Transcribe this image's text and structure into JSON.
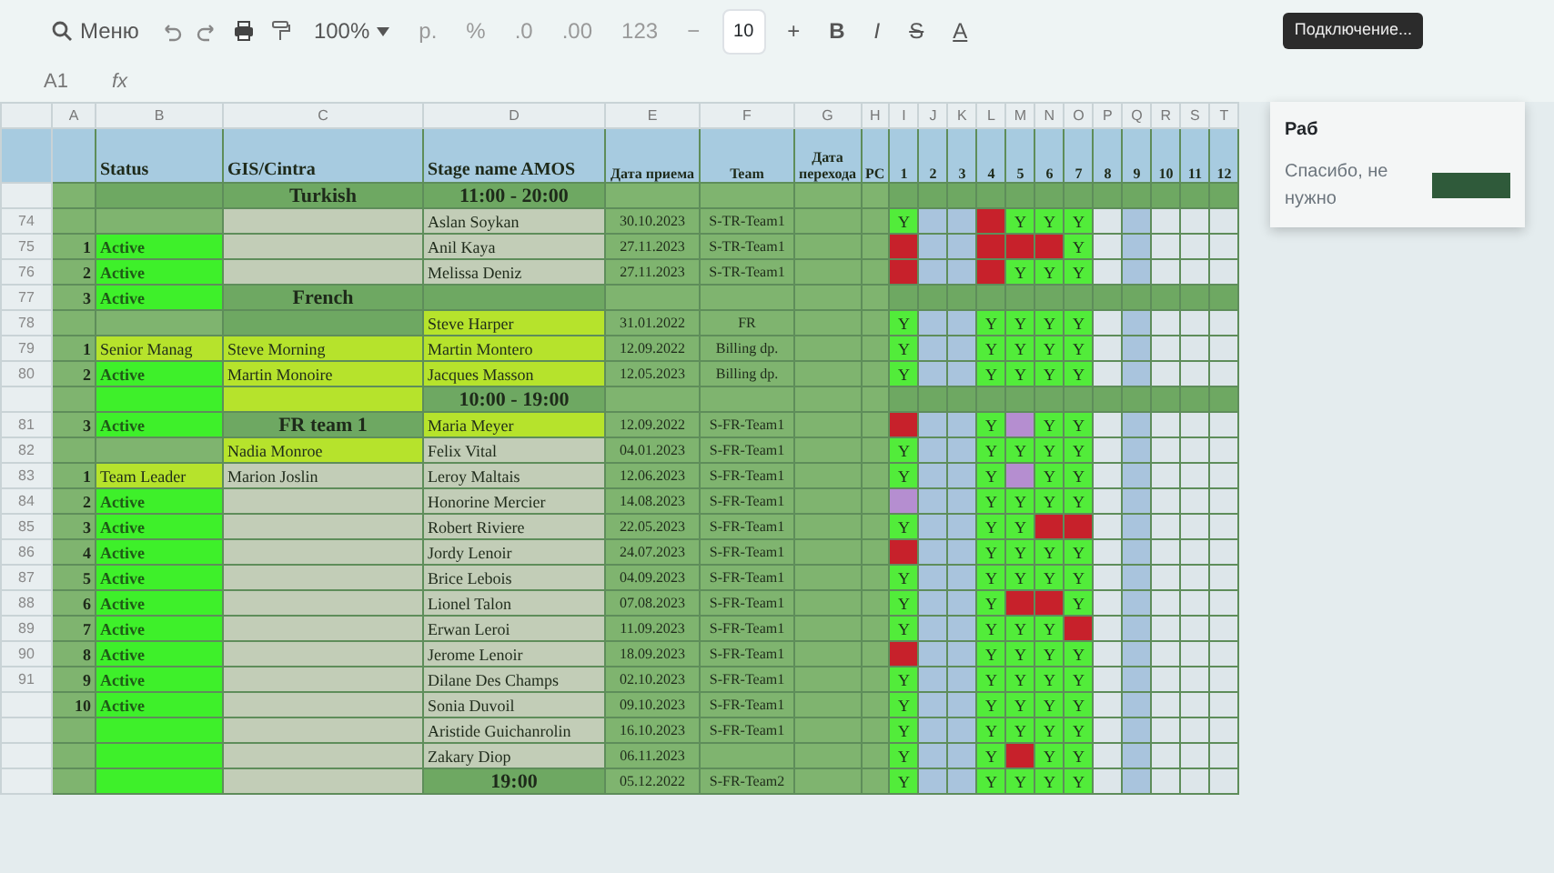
{
  "toolbar": {
    "menu": "Меню",
    "zoom": "100%",
    "currency": "р.",
    "percent": "%",
    "decimals_less": ".0",
    "decimals_more": ".00",
    "number_format": "123",
    "font_minus": "−",
    "font_size": "10",
    "font_plus": "+",
    "bold": "B",
    "italic": "I",
    "strike": "S",
    "text_color": "A"
  },
  "connection_chip": "Подключение...",
  "formula_bar": {
    "cell_ref": "A1",
    "fx": "fx"
  },
  "column_letters": [
    "A",
    "B",
    "C",
    "D",
    "E",
    "F",
    "G",
    "H"
  ],
  "day_letters": [
    "I",
    "J",
    "K",
    "L",
    "M",
    "N",
    "O",
    "P",
    "Q",
    "R",
    "S",
    "T"
  ],
  "headers": [
    "Status",
    "GIS/Cintra",
    "Stage name AMOS",
    "Дата приема",
    "Team",
    "Дата перехода",
    "PC"
  ],
  "day_numbers": [
    "1",
    "2",
    "3",
    "4",
    "5",
    "6",
    "7",
    "8",
    "9",
    "10",
    "11",
    "12"
  ],
  "rows": [
    {
      "kind": "section",
      "cells": [
        {
          "kind": "plain"
        },
        {
          "kind": "section"
        },
        {
          "kind": "section",
          "text": "Turkish"
        },
        {
          "kind": "section",
          "text": "11:00 - 20:00"
        },
        {
          "kind": "plain"
        },
        {
          "kind": "plain"
        }
      ]
    },
    {
      "kind": "person",
      "number": "74",
      "cells": [
        {
          "kind": "plain"
        },
        {
          "kind": "plain"
        },
        {
          "kind": "blank"
        },
        {
          "kind": "blank",
          "text": "Aslan Soykan"
        },
        {
          "kind": "plain",
          "text": "30.10.2023"
        },
        {
          "kind": "plain",
          "text": "S-TR-Team1"
        }
      ],
      "days": [
        {
          "kind": "work",
          "text": "Y"
        },
        {
          "kind": "off"
        },
        {
          "kind": "work",
          "text": "Y"
        },
        {
          "kind": "work",
          "text": "Y"
        },
        {
          "kind": "work",
          "text": "Y"
        }
      ]
    },
    {
      "kind": "person",
      "number": "75",
      "cells": [
        {
          "kind": "plain",
          "text": "1"
        },
        {
          "kind": "active",
          "text": "Active"
        },
        {
          "kind": "blank"
        },
        {
          "kind": "blank",
          "text": "Anil Kaya"
        },
        {
          "kind": "plain",
          "text": "27.11.2023"
        },
        {
          "kind": "plain",
          "text": "S-TR-Team1"
        }
      ],
      "days": [
        {
          "kind": "off"
        },
        {
          "kind": "off"
        },
        {
          "kind": "off"
        },
        {
          "kind": "off"
        },
        {
          "kind": "work",
          "text": "Y"
        }
      ]
    },
    {
      "kind": "person",
      "number": "76",
      "cells": [
        {
          "kind": "plain",
          "text": "2"
        },
        {
          "kind": "active",
          "text": "Active"
        },
        {
          "kind": "blank"
        },
        {
          "kind": "blank",
          "text": "Melissa Deniz"
        },
        {
          "kind": "plain",
          "text": "27.11.2023"
        },
        {
          "kind": "plain",
          "text": "S-TR-Team1"
        }
      ],
      "days": [
        {
          "kind": "off"
        },
        {
          "kind": "off"
        },
        {
          "kind": "work",
          "text": "Y"
        },
        {
          "kind": "work",
          "text": "Y"
        },
        {
          "kind": "work",
          "text": "Y"
        }
      ]
    },
    {
      "kind": "section",
      "number": "77",
      "cells": [
        {
          "kind": "plain",
          "text": "3"
        },
        {
          "kind": "active",
          "text": "Active"
        },
        {
          "kind": "section",
          "text": "French"
        },
        {
          "kind": "section"
        },
        {
          "kind": "plain"
        },
        {
          "kind": "plain"
        }
      ]
    },
    {
      "kind": "person",
      "number": "78",
      "cells": [
        {
          "kind": "plain"
        },
        {
          "kind": "plain"
        },
        {
          "kind": "section"
        },
        {
          "kind": "highlight",
          "text": "Steve Harper"
        },
        {
          "kind": "plain",
          "text": "31.01.2022"
        },
        {
          "kind": "plain",
          "text": "FR"
        }
      ],
      "days": [
        {
          "kind": "work",
          "text": "Y"
        },
        {
          "kind": "work",
          "text": "Y"
        },
        {
          "kind": "work",
          "text": "Y"
        },
        {
          "kind": "work",
          "text": "Y"
        },
        {
          "kind": "work",
          "text": "Y"
        }
      ]
    },
    {
      "kind": "person",
      "number": "79",
      "cells": [
        {
          "kind": "plain",
          "text": "1"
        },
        {
          "kind": "highlight",
          "text": "Senior Manag"
        },
        {
          "kind": "highlight",
          "text": "Steve Morning"
        },
        {
          "kind": "highlight",
          "text": "Martin Montero"
        },
        {
          "kind": "plain",
          "text": "12.09.2022"
        },
        {
          "kind": "plain",
          "text": "Billing dp."
        }
      ],
      "days": [
        {
          "kind": "work",
          "text": "Y"
        },
        {
          "kind": "work",
          "text": "Y"
        },
        {
          "kind": "work",
          "text": "Y"
        },
        {
          "kind": "work",
          "text": "Y"
        },
        {
          "kind": "work",
          "text": "Y"
        }
      ]
    },
    {
      "kind": "person",
      "number": "80",
      "cells": [
        {
          "kind": "plain",
          "text": "2"
        },
        {
          "kind": "active",
          "text": "Active"
        },
        {
          "kind": "highlight",
          "text": "Martin Monoire"
        },
        {
          "kind": "highlight",
          "text": "Jacques Masson"
        },
        {
          "kind": "plain",
          "text": "12.05.2023"
        },
        {
          "kind": "plain",
          "text": "Billing dp."
        }
      ],
      "days": [
        {
          "kind": "work",
          "text": "Y"
        },
        {
          "kind": "work",
          "text": "Y"
        },
        {
          "kind": "work",
          "text": "Y"
        },
        {
          "kind": "work",
          "text": "Y"
        },
        {
          "kind": "work",
          "text": "Y"
        }
      ]
    },
    {
      "kind": "section",
      "cells": [
        {
          "kind": "plain"
        },
        {
          "kind": "active"
        },
        {
          "kind": "highlight"
        },
        {
          "kind": "section",
          "text": "10:00 - 19:00"
        },
        {
          "kind": "plain"
        },
        {
          "kind": "plain"
        }
      ]
    },
    {
      "kind": "person",
      "number": "81",
      "cells": [
        {
          "kind": "plain",
          "text": "3"
        },
        {
          "kind": "active",
          "text": "Active"
        },
        {
          "kind": "section",
          "text": "FR team 1"
        },
        {
          "kind": "highlight",
          "text": "Maria Meyer"
        },
        {
          "kind": "plain",
          "text": "12.09.2022"
        },
        {
          "kind": "plain",
          "text": "S-FR-Team1"
        }
      ],
      "days": [
        {
          "kind": "off"
        },
        {
          "kind": "work",
          "text": "Y"
        },
        {
          "kind": "extra"
        },
        {
          "kind": "work",
          "text": "Y"
        },
        {
          "kind": "work",
          "text": "Y"
        }
      ]
    },
    {
      "kind": "person",
      "number": "82",
      "cells": [
        {
          "kind": "plain"
        },
        {
          "kind": "plain"
        },
        {
          "kind": "highlight",
          "text": "Nadia Monroe"
        },
        {
          "kind": "blank",
          "text": "Felix Vital"
        },
        {
          "kind": "plain",
          "text": "04.01.2023"
        },
        {
          "kind": "plain",
          "text": "S-FR-Team1"
        }
      ],
      "days": [
        {
          "kind": "work",
          "text": "Y"
        },
        {
          "kind": "work",
          "text": "Y"
        },
        {
          "kind": "work",
          "text": "Y"
        },
        {
          "kind": "work",
          "text": "Y"
        },
        {
          "kind": "work",
          "text": "Y"
        }
      ]
    },
    {
      "kind": "person",
      "number": "83",
      "cells": [
        {
          "kind": "plain",
          "text": "1"
        },
        {
          "kind": "highlight",
          "text": "Team Leader"
        },
        {
          "kind": "blank",
          "text": "Marion Joslin"
        },
        {
          "kind": "blank",
          "text": "Leroy Maltais"
        },
        {
          "kind": "plain",
          "text": "12.06.2023"
        },
        {
          "kind": "plain",
          "text": "S-FR-Team1"
        }
      ],
      "days": [
        {
          "kind": "work",
          "text": "Y"
        },
        {
          "kind": "work",
          "text": "Y"
        },
        {
          "kind": "extra"
        },
        {
          "kind": "work",
          "text": "Y"
        },
        {
          "kind": "work",
          "text": "Y"
        }
      ]
    },
    {
      "kind": "person",
      "number": "84",
      "cells": [
        {
          "kind": "plain",
          "text": "2"
        },
        {
          "kind": "active",
          "text": "Active"
        },
        {
          "kind": "blank"
        },
        {
          "kind": "blank",
          "text": "Honorine Mercier"
        },
        {
          "kind": "plain",
          "text": "14.08.2023"
        },
        {
          "kind": "plain",
          "text": "S-FR-Team1"
        }
      ],
      "days": [
        {
          "kind": "extra"
        },
        {
          "kind": "work",
          "text": "Y"
        },
        {
          "kind": "work",
          "text": "Y"
        },
        {
          "kind": "work",
          "text": "Y"
        },
        {
          "kind": "work",
          "text": "Y"
        }
      ]
    },
    {
      "kind": "person",
      "number": "85",
      "cells": [
        {
          "kind": "plain",
          "text": "3"
        },
        {
          "kind": "active",
          "text": "Active"
        },
        {
          "kind": "blank"
        },
        {
          "kind": "blank",
          "text": "Robert Riviere"
        },
        {
          "kind": "plain",
          "text": "22.05.2023"
        },
        {
          "kind": "plain",
          "text": "S-FR-Team1"
        }
      ],
      "days": [
        {
          "kind": "work",
          "text": "Y"
        },
        {
          "kind": "work",
          "text": "Y"
        },
        {
          "kind": "work",
          "text": "Y"
        },
        {
          "kind": "off"
        },
        {
          "kind": "off"
        }
      ]
    },
    {
      "kind": "person",
      "number": "86",
      "cells": [
        {
          "kind": "plain",
          "text": "4"
        },
        {
          "kind": "active",
          "text": "Active"
        },
        {
          "kind": "blank"
        },
        {
          "kind": "blank",
          "text": "Jordy Lenoir"
        },
        {
          "kind": "plain",
          "text": "24.07.2023"
        },
        {
          "kind": "plain",
          "text": "S-FR-Team1"
        }
      ],
      "days": [
        {
          "kind": "off"
        },
        {
          "kind": "work",
          "text": "Y"
        },
        {
          "kind": "work",
          "text": "Y"
        },
        {
          "kind": "work",
          "text": "Y"
        },
        {
          "kind": "work",
          "text": "Y"
        }
      ]
    },
    {
      "kind": "person",
      "number": "87",
      "cells": [
        {
          "kind": "plain",
          "text": "5"
        },
        {
          "kind": "active",
          "text": "Active"
        },
        {
          "kind": "blank"
        },
        {
          "kind": "blank",
          "text": "Brice Lebois"
        },
        {
          "kind": "plain",
          "text": "04.09.2023"
        },
        {
          "kind": "plain",
          "text": "S-FR-Team1"
        }
      ],
      "days": [
        {
          "kind": "work",
          "text": "Y"
        },
        {
          "kind": "work",
          "text": "Y"
        },
        {
          "kind": "work",
          "text": "Y"
        },
        {
          "kind": "work",
          "text": "Y"
        },
        {
          "kind": "work",
          "text": "Y"
        }
      ]
    },
    {
      "kind": "person",
      "number": "88",
      "cells": [
        {
          "kind": "plain",
          "text": "6"
        },
        {
          "kind": "active",
          "text": "Active"
        },
        {
          "kind": "blank"
        },
        {
          "kind": "blank",
          "text": "Lionel Talon"
        },
        {
          "kind": "plain",
          "text": "07.08.2023"
        },
        {
          "kind": "plain",
          "text": "S-FR-Team1"
        }
      ],
      "days": [
        {
          "kind": "work",
          "text": "Y"
        },
        {
          "kind": "work",
          "text": "Y"
        },
        {
          "kind": "off"
        },
        {
          "kind": "off"
        },
        {
          "kind": "work",
          "text": "Y"
        }
      ]
    },
    {
      "kind": "person",
      "number": "89",
      "cells": [
        {
          "kind": "plain",
          "text": "7"
        },
        {
          "kind": "active",
          "text": "Active"
        },
        {
          "kind": "blank"
        },
        {
          "kind": "blank",
          "text": "Erwan Leroi"
        },
        {
          "kind": "plain",
          "text": "11.09.2023"
        },
        {
          "kind": "plain",
          "text": "S-FR-Team1"
        }
      ],
      "days": [
        {
          "kind": "work",
          "text": "Y"
        },
        {
          "kind": "work",
          "text": "Y"
        },
        {
          "kind": "work",
          "text": "Y"
        },
        {
          "kind": "work",
          "text": "Y"
        },
        {
          "kind": "off"
        }
      ]
    },
    {
      "kind": "person",
      "number": "90",
      "cells": [
        {
          "kind": "plain",
          "text": "8"
        },
        {
          "kind": "active",
          "text": "Active"
        },
        {
          "kind": "blank"
        },
        {
          "kind": "blank",
          "text": "Jerome Lenoir"
        },
        {
          "kind": "plain",
          "text": "18.09.2023"
        },
        {
          "kind": "plain",
          "text": "S-FR-Team1"
        }
      ],
      "days": [
        {
          "kind": "off"
        },
        {
          "kind": "work",
          "text": "Y"
        },
        {
          "kind": "work",
          "text": "Y"
        },
        {
          "kind": "work",
          "text": "Y"
        },
        {
          "kind": "work",
          "text": "Y"
        }
      ]
    },
    {
      "kind": "person",
      "number": "91",
      "cells": [
        {
          "kind": "plain",
          "text": "9"
        },
        {
          "kind": "active",
          "text": "Active"
        },
        {
          "kind": "blank"
        },
        {
          "kind": "blank",
          "text": "Dilane Des Champs"
        },
        {
          "kind": "plain",
          "text": "02.10.2023"
        },
        {
          "kind": "plain",
          "text": "S-FR-Team1"
        }
      ],
      "days": [
        {
          "kind": "work",
          "text": "Y"
        },
        {
          "kind": "work",
          "text": "Y"
        },
        {
          "kind": "work",
          "text": "Y"
        },
        {
          "kind": "work",
          "text": "Y"
        },
        {
          "kind": "work",
          "text": "Y"
        }
      ]
    },
    {
      "kind": "person",
      "cells": [
        {
          "kind": "plain",
          "text": "10"
        },
        {
          "kind": "active",
          "text": "Active"
        },
        {
          "kind": "blank"
        },
        {
          "kind": "blank",
          "text": "Sonia Duvoil"
        },
        {
          "kind": "plain",
          "text": "09.10.2023"
        },
        {
          "kind": "plain",
          "text": "S-FR-Team1"
        }
      ],
      "days": [
        {
          "kind": "work",
          "text": "Y"
        },
        {
          "kind": "work",
          "text": "Y"
        },
        {
          "kind": "work",
          "text": "Y"
        },
        {
          "kind": "work",
          "text": "Y"
        },
        {
          "kind": "work",
          "text": "Y"
        }
      ]
    },
    {
      "kind": "person",
      "cells": [
        {
          "kind": "plain"
        },
        {
          "kind": "active"
        },
        {
          "kind": "blank"
        },
        {
          "kind": "blank",
          "text": "Aristide Guichanrolin"
        },
        {
          "kind": "plain",
          "text": "16.10.2023"
        },
        {
          "kind": "plain",
          "text": "S-FR-Team1"
        }
      ],
      "days": [
        {
          "kind": "work",
          "text": "Y"
        },
        {
          "kind": "work",
          "text": "Y"
        },
        {
          "kind": "work",
          "text": "Y"
        },
        {
          "kind": "work",
          "text": "Y"
        },
        {
          "kind": "work",
          "text": "Y"
        }
      ]
    },
    {
      "kind": "person",
      "cells": [
        {
          "kind": "plain"
        },
        {
          "kind": "active"
        },
        {
          "kind": "blank"
        },
        {
          "kind": "blank",
          "text": "Zakary Diop"
        },
        {
          "kind": "plain",
          "text": "06.11.2023"
        },
        {
          "kind": "plain"
        }
      ],
      "days": [
        {
          "kind": "work",
          "text": "Y"
        },
        {
          "kind": "work",
          "text": "Y"
        },
        {
          "kind": "off"
        },
        {
          "kind": "work",
          "text": "Y"
        },
        {
          "kind": "work",
          "text": "Y"
        }
      ]
    },
    {
      "kind": "person",
      "cells": [
        {
          "kind": "plain"
        },
        {
          "kind": "active"
        },
        {
          "kind": "blank"
        },
        {
          "kind": "section",
          "text": "19:00"
        },
        {
          "kind": "plain",
          "text": "05.12.2022"
        },
        {
          "kind": "plain",
          "text": "S-FR-Team2"
        }
      ],
      "days": [
        {
          "kind": "work",
          "text": "Y"
        },
        {
          "kind": "work",
          "text": "Y"
        },
        {
          "kind": "work",
          "text": "Y"
        },
        {
          "kind": "work",
          "text": "Y"
        },
        {
          "kind": "work",
          "text": "Y"
        }
      ]
    }
  ],
  "dialog": {
    "title": "Раб",
    "dismiss": "Спасибо, не нужно"
  }
}
